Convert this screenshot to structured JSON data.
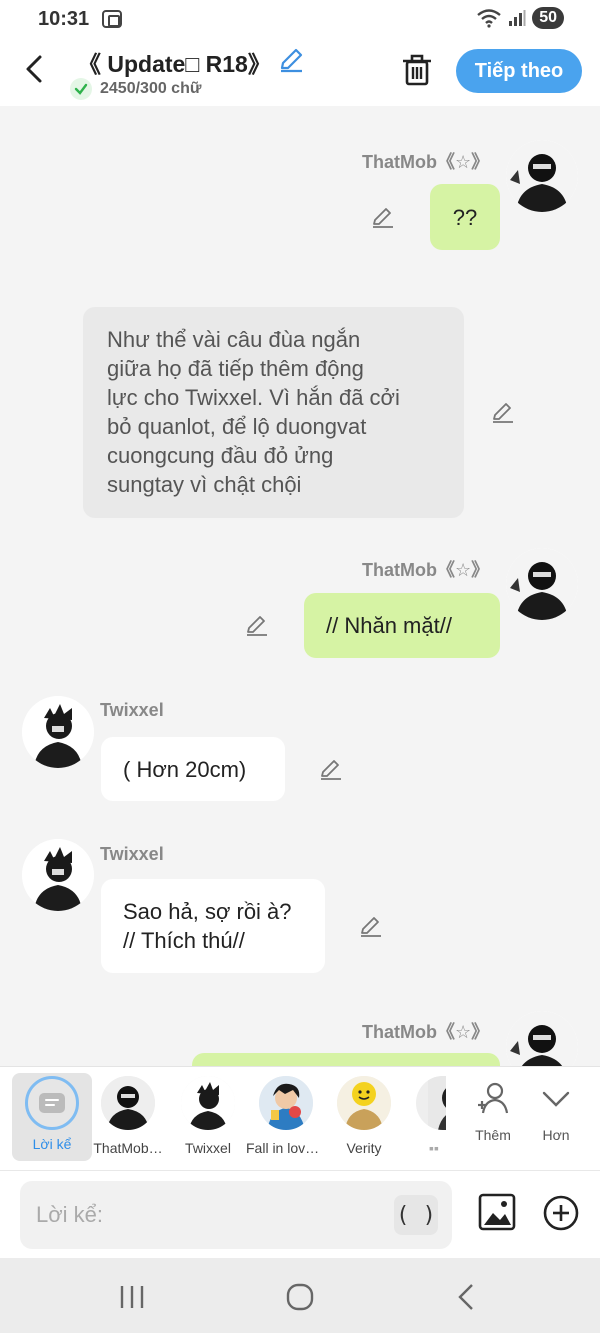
{
  "status": {
    "time": "10:31",
    "battery": "50"
  },
  "header": {
    "title": "《 Update□ R18》",
    "word_count": "2450/300 chữ",
    "next_label": "Tiếp theo"
  },
  "messages": [
    {
      "sender": "ThatMob《☆》",
      "text": "??",
      "side": "right",
      "avatar": "thatmob-avatar"
    },
    {
      "sender": "",
      "text": "Như thể vài câu đùa ngắn\ngiữa họ đã tiếp thêm động\nlực cho Twixxel. Vì hắn đã cởi\nbỏ quanlot, để lộ duongvat\ncuongcung đầu đỏ ửng\nsungtay vì chật chội",
      "side": "narration"
    },
    {
      "sender": "ThatMob《☆》",
      "text": "// Nhăn mặt//",
      "side": "right",
      "avatar": "thatmob-avatar"
    },
    {
      "sender": "Twixxel",
      "text": "( Hơn 20cm)",
      "side": "left",
      "avatar": "twixxel-avatar"
    },
    {
      "sender": "Twixxel",
      "text": "Sao hả, sợ rồi à?\n// Thích thú//",
      "side": "left",
      "avatar": "twixxel-avatar"
    },
    {
      "sender": "ThatMob《☆》",
      "text": "",
      "side": "right",
      "avatar": "thatmob-avatar"
    }
  ],
  "characters": [
    {
      "name": "Lời kể",
      "selected": true
    },
    {
      "name": "ThatMob…"
    },
    {
      "name": "Twixxel"
    },
    {
      "name": "Fall in love…"
    },
    {
      "name": "Verity"
    },
    {
      "name": "▪▪"
    }
  ],
  "tools": {
    "add_label": "Thêm",
    "more_label": "Hơn"
  },
  "input": {
    "placeholder": "Lời kể:",
    "paren_label": "( )"
  },
  "colors": {
    "accent": "#4aa3ee",
    "bubble_green": "#d6f3a4",
    "narration_bg": "#e9e9e9"
  }
}
